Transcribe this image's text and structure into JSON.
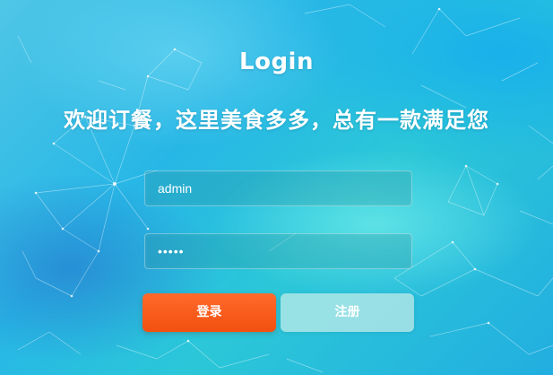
{
  "header": {
    "title": "Login",
    "subtitle": "欢迎订餐，这里美食多多，总有一款满足您"
  },
  "form": {
    "username_value": "admin",
    "password_value": "•••••"
  },
  "buttons": {
    "login_label": "登录",
    "register_label": "注册"
  },
  "colors": {
    "login_button": "#f25a17",
    "register_button": "#a9e1df",
    "text": "#ffffff"
  }
}
